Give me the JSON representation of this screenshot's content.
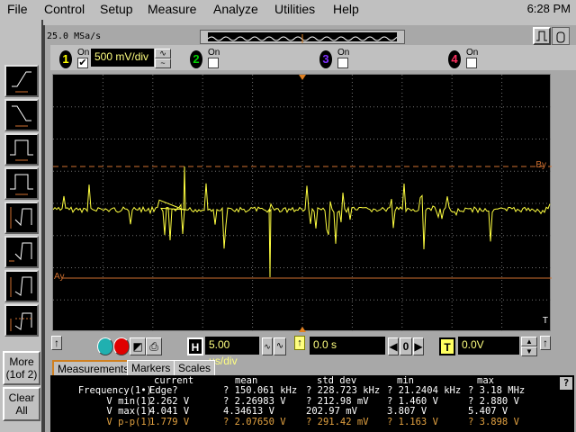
{
  "menu": {
    "items": [
      "File",
      "Control",
      "Setup",
      "Measure",
      "Analyze",
      "Utilities",
      "Help"
    ],
    "clock": "6:28 PM"
  },
  "acq": {
    "sample_rate": "25.0 MSa/s"
  },
  "channels": [
    {
      "num": "1",
      "on_label": "On",
      "checked": true,
      "scale": "500 mV/div",
      "color": "#ffff00"
    },
    {
      "num": "2",
      "on_label": "On",
      "checked": false,
      "color": "#00d000"
    },
    {
      "num": "3",
      "on_label": "On",
      "checked": false,
      "color": "#8030ff"
    },
    {
      "num": "4",
      "on_label": "On",
      "checked": false,
      "color": "#ff3060"
    }
  ],
  "plot": {
    "marker_b": "By",
    "marker_a": "Ay",
    "trig_label": "T"
  },
  "left": {
    "more": "More",
    "more_page": "(1of 2)",
    "clear": "Clear",
    "clear2": "All"
  },
  "bottom": {
    "h_label": "H",
    "timebase": "5.00 µs/div",
    "delay": "0.0 s",
    "delay_ref": "0",
    "t_label": "T",
    "trigger_level": "0.0V"
  },
  "tabs": [
    "Measurements",
    "Markers",
    "Scales"
  ],
  "measurements": {
    "headers": [
      "current",
      "mean",
      "std dev",
      "min",
      "max"
    ],
    "rows": [
      {
        "name": "Frequency(1•)",
        "current": "Edge?",
        "mean": "? 150.061 kHz",
        "std": "? 228.723 kHz",
        "min": "? 21.2404 kHz",
        "max": "? 3.18 MHz"
      },
      {
        "name": "V min(1)",
        "current": "2.262 V",
        "mean": "? 2.26983 V",
        "std": "? 212.98 mV",
        "min": "? 1.460 V",
        "max": "? 2.880 V"
      },
      {
        "name": "V max(1)",
        "current": "4.041 V",
        "mean": "4.34613 V",
        "std": "202.97 mV",
        "min": "3.807 V",
        "max": "5.407 V"
      },
      {
        "name": "V p-p(1)",
        "current": "1.779 V",
        "mean": "? 2.07650 V",
        "std": "? 291.42 mV",
        "min": "? 1.163 V",
        "max": "? 3.898 V"
      }
    ],
    "help": "?"
  },
  "colors": {
    "trace": "#ffff40",
    "marker": "#d07030",
    "grid": "#707070"
  }
}
